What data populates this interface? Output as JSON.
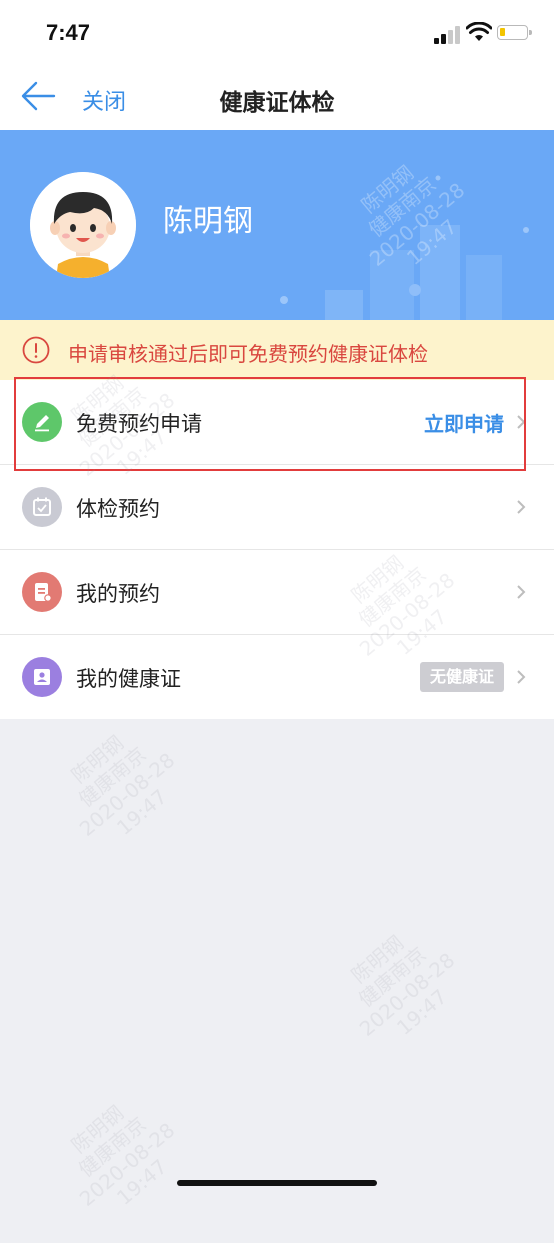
{
  "status_bar": {
    "time": "7:47"
  },
  "nav": {
    "close_label": "关闭",
    "title": "健康证体检"
  },
  "profile": {
    "name": "陈明钢"
  },
  "notice": {
    "text": "申请审核通过后即可免费预约健康证体检"
  },
  "menu": {
    "items": [
      {
        "label": "免费预约申请",
        "action": "立即申请",
        "icon": "pencil-icon",
        "icon_color": "#5ec76a"
      },
      {
        "label": "体检预约",
        "icon": "calendar-icon",
        "icon_color": "#c9cad3"
      },
      {
        "label": "我的预约",
        "icon": "document-icon",
        "icon_color": "#e27a73"
      },
      {
        "label": "我的健康证",
        "badge": "无健康证",
        "icon": "id-card-icon",
        "icon_color": "#9b7fe0"
      }
    ]
  },
  "watermark": {
    "line1": "陈明钢",
    "line2": "健康南京",
    "line3": "2020-08-28",
    "line4": "19:47"
  },
  "colors": {
    "accent": "#3a8ee6",
    "banner": "#6aa8f6",
    "notice_bg": "#fdf3cc",
    "notice_text": "#d9473f",
    "highlight": "#e23c3c"
  }
}
